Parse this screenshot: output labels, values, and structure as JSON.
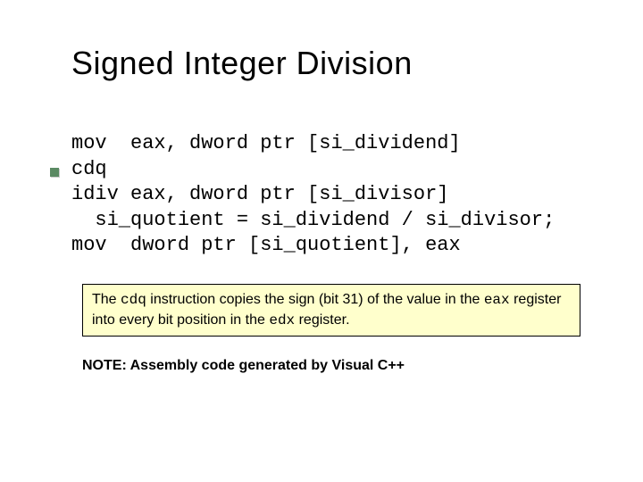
{
  "title": "Signed Integer Division",
  "code": {
    "l1": "mov  eax, dword ptr [si_dividend]",
    "l2": "cdq",
    "l3": "idiv eax, dword ptr [si_divisor]",
    "l4": "  si_quotient = si_dividend / si_divisor;",
    "l5": "mov  dword ptr [si_quotient], eax"
  },
  "callout": {
    "t1": "The ",
    "m1": "cdq",
    "t2": " instruction copies the sign (bit 31) of the value in the ",
    "m2": "eax",
    "t3": " register into every bit position in the ",
    "m3": "edx",
    "t4": " register."
  },
  "note": "NOTE: Assembly code generated by Visual C++"
}
